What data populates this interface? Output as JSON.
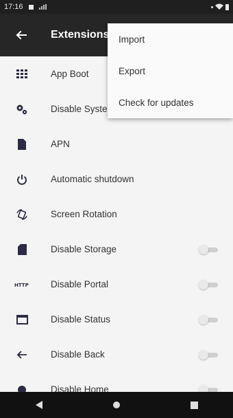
{
  "status_bar": {
    "time": "17:16"
  },
  "app_bar": {
    "title": "Extensions",
    "back_icon": "arrow-left-icon"
  },
  "menu": {
    "items": [
      {
        "label": "Import"
      },
      {
        "label": "Export"
      },
      {
        "label": "Check for updates"
      }
    ]
  },
  "list": {
    "items": [
      {
        "label": "App Boot",
        "icon": "grid-icon"
      },
      {
        "label": "Disable System",
        "icon": "gears-icon"
      },
      {
        "label": "APN",
        "icon": "document-icon"
      },
      {
        "label": "Automatic shutdown",
        "icon": "power-icon"
      },
      {
        "label": "Screen Rotation",
        "icon": "rotation-icon"
      },
      {
        "label": "Disable Storage",
        "icon": "sd-card-icon",
        "toggle": false
      },
      {
        "label": "Disable Portal",
        "icon": "http-icon",
        "icon_text": "HTTP",
        "toggle": false
      },
      {
        "label": "Disable Status",
        "icon": "status-bar-icon",
        "toggle": false
      },
      {
        "label": "Disable Back",
        "icon": "back-arrow-icon",
        "toggle": false
      },
      {
        "label": "Disable Home",
        "icon": "home-circle-icon",
        "toggle": false
      }
    ]
  },
  "nav_bar": {
    "icons": [
      "nav-back-icon",
      "nav-home-icon",
      "nav-recents-icon"
    ]
  }
}
